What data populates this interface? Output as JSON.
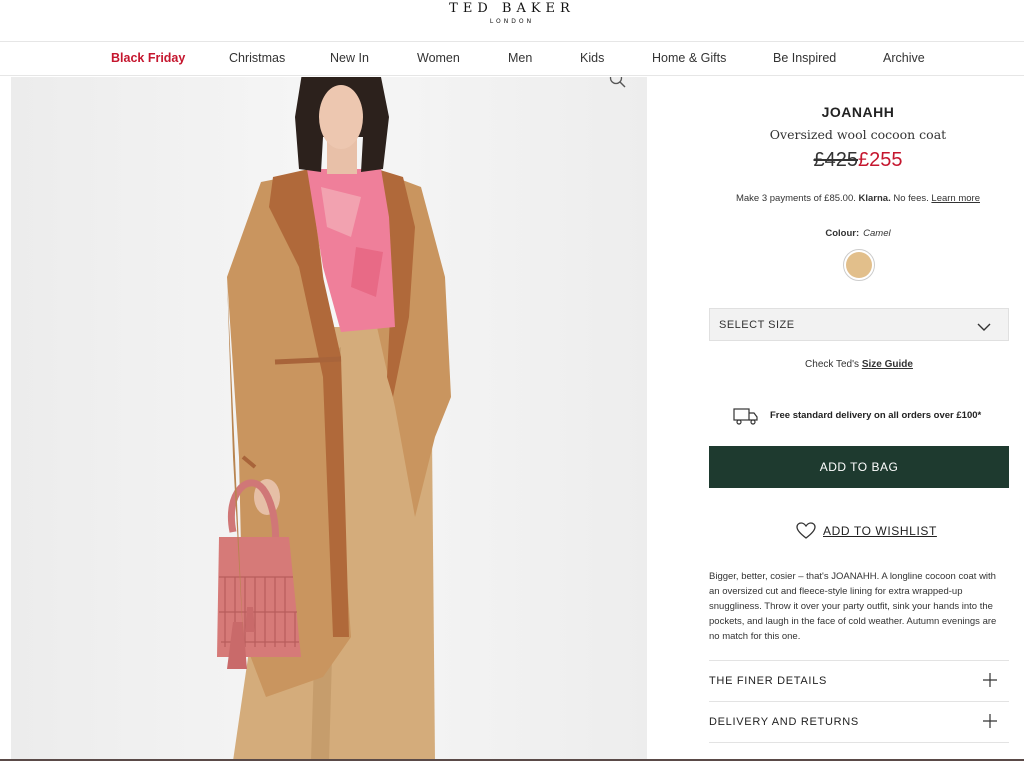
{
  "header": {
    "logo_main": "TED BAKER",
    "logo_sub": "LONDON"
  },
  "nav": {
    "items": [
      {
        "label": "Black Friday",
        "accent": true
      },
      {
        "label": "Christmas"
      },
      {
        "label": "New In"
      },
      {
        "label": "Women"
      },
      {
        "label": "Men"
      },
      {
        "label": "Kids"
      },
      {
        "label": "Home & Gifts"
      },
      {
        "label": "Be Inspired"
      },
      {
        "label": "Archive"
      }
    ]
  },
  "product": {
    "name": "JOANAHH",
    "subtitle": "Oversized wool cocoon coat",
    "price_old": "£425",
    "price_new": "£255",
    "klarna_prefix": "Make 3 payments of £85.00.",
    "klarna_brand": "Klarna.",
    "klarna_suffix": "No fees.",
    "klarna_link": "Learn more",
    "colour_label": "Colour:",
    "colour_value": "Camel",
    "size_select_label": "SELECT SIZE",
    "size_guide_prefix": "Check Ted's",
    "size_guide_link": "Size Guide",
    "delivery_text": "Free standard delivery on all orders over £100*",
    "add_to_bag": "ADD TO BAG",
    "wishlist": "ADD TO WISHLIST",
    "description": "Bigger, better, cosier – that's JOANAHH. A longline cocoon coat with an oversized cut and fleece-style lining for extra wrapped-up snuggliness. Throw it over your party outfit, sink your hands into the pockets, and laugh in the face of cold weather. Autumn evenings are no match for this one.",
    "accordions": [
      {
        "label": "THE FINER DETAILS"
      },
      {
        "label": "DELIVERY AND RETURNS"
      }
    ]
  },
  "colors": {
    "accent_red": "#c5162e",
    "button_green": "#1e3a2f",
    "swatch_camel": "#e2bf8b"
  },
  "icons": {
    "zoom": "magnifier-icon",
    "chevron": "chevron-down-icon",
    "truck": "delivery-truck-icon",
    "heart": "heart-icon",
    "plus": "plus-icon"
  }
}
